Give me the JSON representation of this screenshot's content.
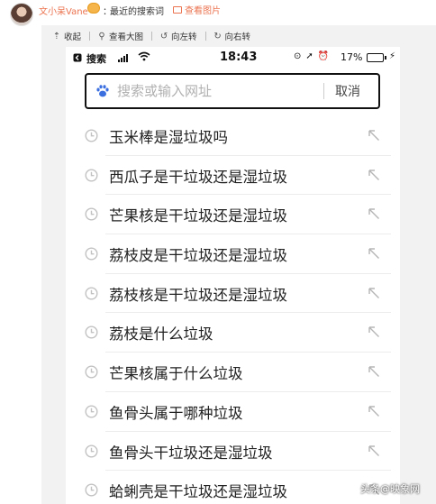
{
  "post": {
    "author": "文小呆Vane",
    "separator": "：",
    "text": "最近的搜索词",
    "view_picture": "查看图片"
  },
  "toolbar": {
    "items": [
      {
        "icon": "collapse-icon",
        "label": "收起"
      },
      {
        "icon": "zoom-icon",
        "label": "查看大图"
      },
      {
        "icon": "rotate-left-icon",
        "label": "向左转"
      },
      {
        "icon": "rotate-right-icon",
        "label": "向右转"
      }
    ]
  },
  "status_bar": {
    "back_label": "搜索",
    "time": "18:43",
    "battery_percent": "17%",
    "battery_level": 0.17
  },
  "search": {
    "placeholder": "搜索或输入网址",
    "cancel_label": "取消"
  },
  "history": [
    "玉米棒是湿垃圾吗",
    "西瓜子是干垃圾还是湿垃圾",
    "芒果核是干垃圾还是湿垃圾",
    "荔枝皮是干垃圾还是湿垃圾",
    "荔枝核是干垃圾还是湿垃圾",
    "荔枝是什么垃圾",
    "芒果核属于什么垃圾",
    "鱼骨头属于哪种垃圾",
    "鱼骨头干垃圾还是湿垃圾",
    "蛤蜊壳是干垃圾还是湿垃圾"
  ],
  "watermark": "头条@映象网",
  "colors": {
    "accent": "#eb7350",
    "frame_bg": "#f2f2f2"
  }
}
